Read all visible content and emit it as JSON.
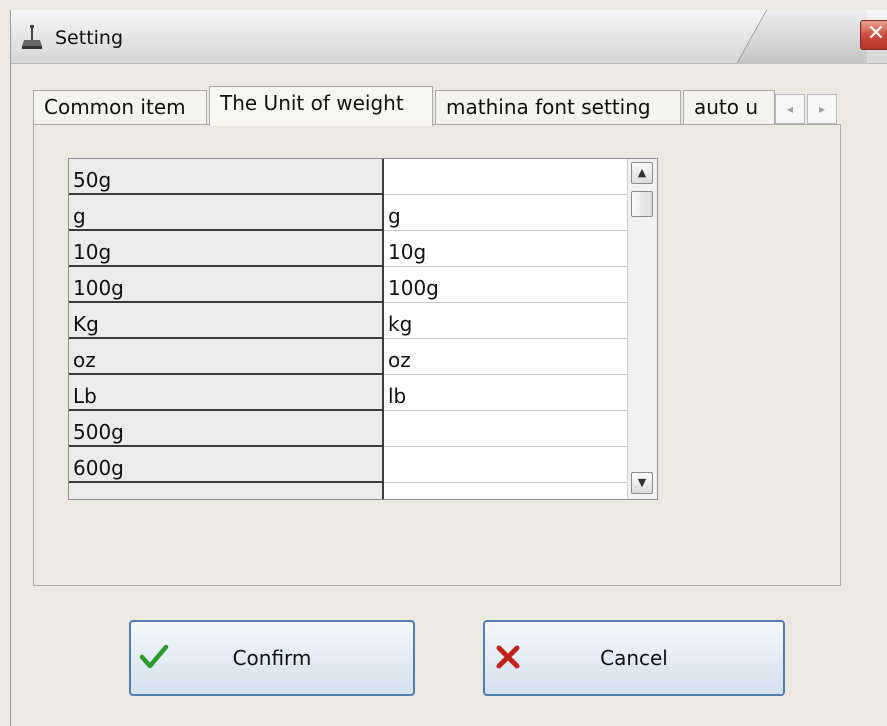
{
  "window": {
    "title": "Setting",
    "close_glyph": "✕"
  },
  "tabs": [
    {
      "label": "Common item",
      "active": false
    },
    {
      "label": "The Unit of weight",
      "active": true
    },
    {
      "label": "mathina font setting",
      "active": false
    },
    {
      "label": "auto u",
      "active": false
    }
  ],
  "tab_scroll": {
    "left_glyph": "◂",
    "right_glyph": "▸"
  },
  "grid": {
    "rows": [
      {
        "name": "50g",
        "value": ""
      },
      {
        "name": "g",
        "value": "g"
      },
      {
        "name": "10g",
        "value": "10g"
      },
      {
        "name": "100g",
        "value": "100g"
      },
      {
        "name": "Kg",
        "value": "kg"
      },
      {
        "name": "oz",
        "value": "oz"
      },
      {
        "name": "Lb",
        "value": "lb"
      },
      {
        "name": "500g",
        "value": ""
      },
      {
        "name": "600g",
        "value": ""
      }
    ],
    "scroll_up_glyph": "▲",
    "scroll_down_glyph": "▼"
  },
  "buttons": {
    "confirm_label": "Confirm",
    "cancel_label": "Cancel"
  },
  "icons": {
    "window": "scale-icon",
    "confirm": "checkmark-icon",
    "cancel": "x-mark-icon"
  },
  "colors": {
    "close_button": "#c9473a",
    "confirm_check": "#2e9a2e",
    "cancel_x": "#c0221a",
    "button_border": "#4f7fb0"
  }
}
